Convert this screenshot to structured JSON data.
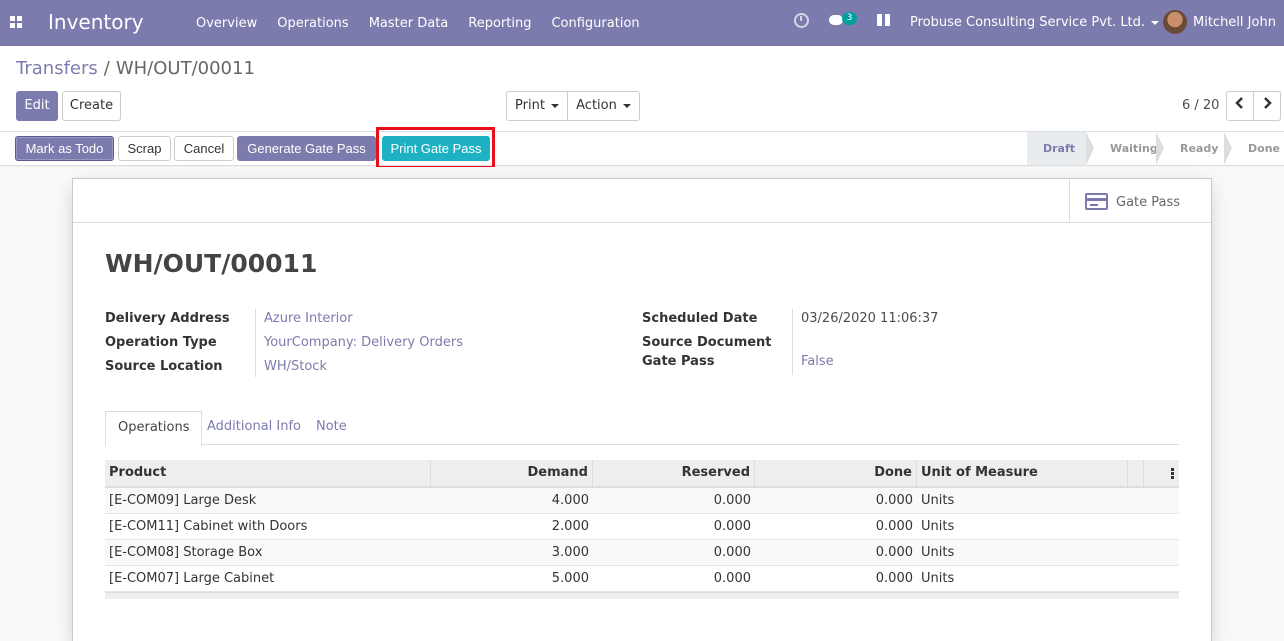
{
  "navbar": {
    "app_title": "Inventory",
    "menu": [
      "Overview",
      "Operations",
      "Master Data",
      "Reporting",
      "Configuration"
    ],
    "chat_count": "3",
    "company": "Probuse Consulting Service Pvt. Ltd.",
    "user": "Mitchell John",
    "icons": [
      "apps-icon",
      "clock-icon",
      "chat-icon",
      "gift-icon",
      "avatar"
    ]
  },
  "breadcrumb": {
    "parent": "Transfers",
    "separator": "/",
    "current": "WH/OUT/00011"
  },
  "buttons": {
    "edit": "Edit",
    "create": "Create",
    "print": "Print",
    "action": "Action"
  },
  "pager": {
    "value": "6 / 20"
  },
  "statusbar": {
    "mark_todo": "Mark as Todo",
    "scrap": "Scrap",
    "cancel": "Cancel",
    "generate_gate_pass": "Generate Gate Pass",
    "print_gate_pass": "Print Gate Pass",
    "stages": [
      "Draft",
      "Waiting",
      "Ready",
      "Done"
    ],
    "active_stage": "Draft"
  },
  "sheet": {
    "stat_button": "Gate Pass",
    "title": "WH/OUT/00011",
    "left_fields": [
      {
        "label": "Delivery Address",
        "value": "Azure Interior"
      },
      {
        "label": "Operation Type",
        "value": "YourCompany: Delivery Orders"
      },
      {
        "label": "Source Location",
        "value": "WH/Stock"
      }
    ],
    "right_fields": [
      {
        "label": "Scheduled Date",
        "value": "03/26/2020 11:06:37"
      },
      {
        "label": "Source Document",
        "value": ""
      },
      {
        "label": "Gate Pass",
        "value": "False"
      }
    ],
    "tabs": [
      "Operations",
      "Additional Info",
      "Note"
    ],
    "active_tab": "Operations"
  },
  "table": {
    "columns": [
      "Product",
      "Demand",
      "Reserved",
      "Done",
      "Unit of Measure"
    ],
    "rows": [
      [
        "[E-COM09] Large Desk",
        "4.000",
        "0.000",
        "0.000",
        "Units"
      ],
      [
        "[E-COM11] Cabinet with Doors",
        "2.000",
        "0.000",
        "0.000",
        "Units"
      ],
      [
        "[E-COM08] Storage Box",
        "3.000",
        "0.000",
        "0.000",
        "Units"
      ],
      [
        "[E-COM07] Large Cabinet",
        "5.000",
        "0.000",
        "0.000",
        "Units"
      ]
    ]
  },
  "colors": {
    "brand": "#7c7bad",
    "print_gate_pass": "#1eb1c3",
    "highlight": "#e8111a"
  }
}
